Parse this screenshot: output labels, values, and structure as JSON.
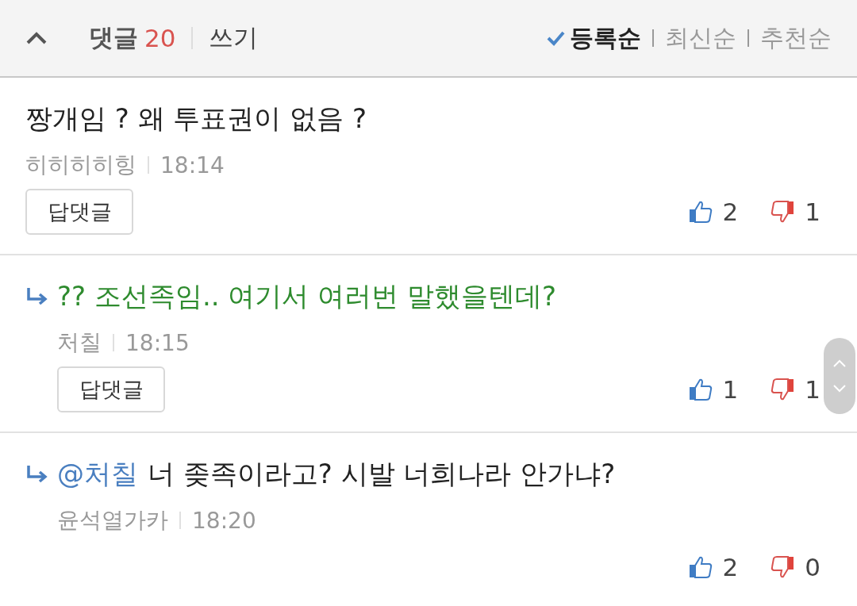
{
  "header": {
    "label": "댓글",
    "count": "20",
    "write": "쓰기",
    "expanded": true
  },
  "sort_options": [
    {
      "label": "등록순",
      "selected": true
    },
    {
      "label": "최신순",
      "selected": false
    },
    {
      "label": "추천순",
      "selected": false
    }
  ],
  "comments": [
    {
      "kind": "comment",
      "text": "짱개임 ? 왜 투표권이 없음 ?",
      "author": "히히히히힝",
      "time": "18:14",
      "reply_button": "답댓글",
      "likes": "2",
      "dislikes": "1"
    },
    {
      "kind": "reply",
      "text": "?? 조선족임.. 여기서 여러번 말했을텐데?",
      "color": "#2e8b2e",
      "author": "처칠",
      "time": "18:15",
      "reply_button": "답댓글",
      "likes": "1",
      "dislikes": "1"
    },
    {
      "kind": "reply",
      "mention": "@처칠",
      "text": "너 좆족이라고? 시발 너희나라 안가냐?",
      "author": "윤석열가카",
      "time": "18:20",
      "likes": "2",
      "dislikes": "0"
    }
  ]
}
